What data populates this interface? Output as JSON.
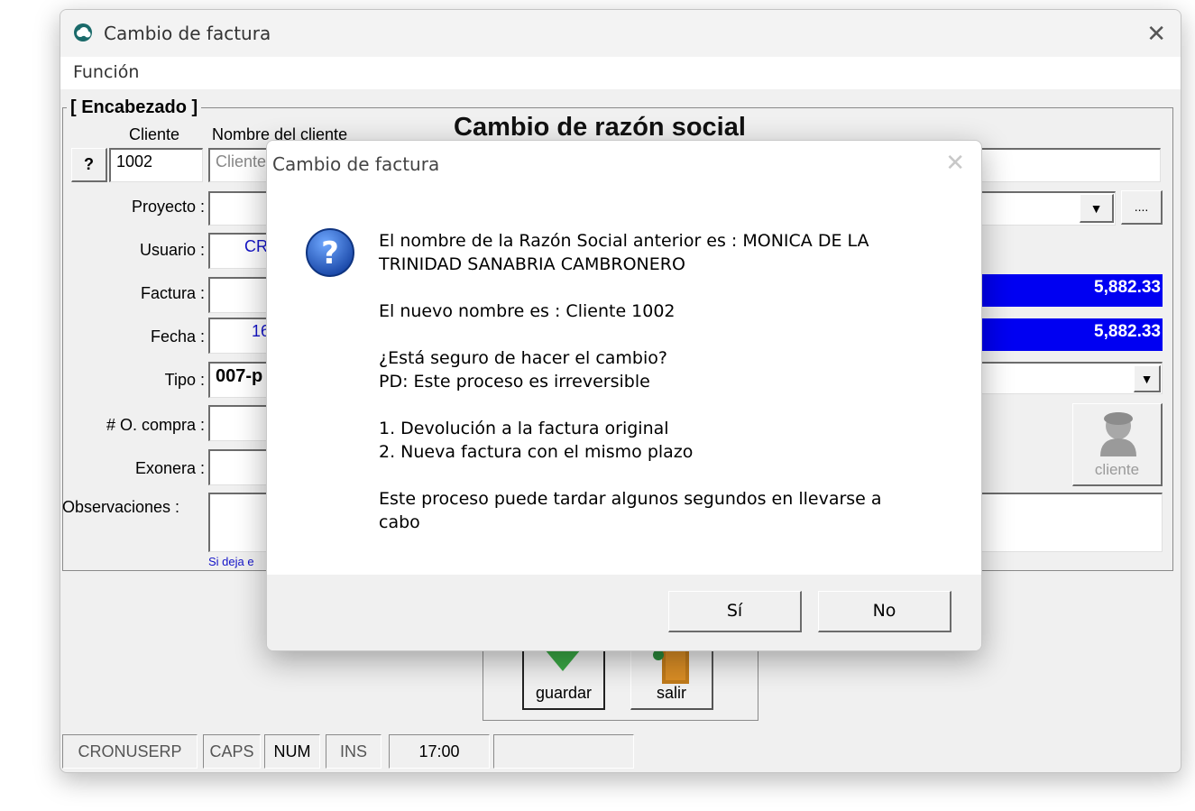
{
  "window": {
    "title": "Cambio de factura"
  },
  "menu": {
    "items": [
      "Función"
    ]
  },
  "form": {
    "group_title": "[ Encabezado ]",
    "heading": "Cambio de razón social",
    "cliente_header": "Cliente",
    "nombre_header": "Nombre del cliente",
    "help_button": "?",
    "cliente_code": "1002",
    "cliente_name": "Cliente",
    "proyecto_label": "Proyecto :",
    "usuario_label": "Usuario :",
    "usuario_value": "CR",
    "factura_label": "Factura :",
    "fecha_label": "Fecha :",
    "fecha_value": "16",
    "tipo_label": "Tipo :",
    "tipo_value": "007-p",
    "ocompra_label": "# O. compra :",
    "exonera_label": "Exonera :",
    "observaciones_label": "Observaciones :",
    "note": "Si deja e",
    "dots_button": "....",
    "amount1": "5,882.33",
    "amount2": "5,882.33",
    "cliente_button": "cliente"
  },
  "toolbar": {
    "guardar": "guardar",
    "salir": "salir"
  },
  "statusbar": {
    "user": "CRONUSERP",
    "caps": "CAPS",
    "num": "NUM",
    "ins": "INS",
    "time": "17:00",
    "extra": ""
  },
  "dialog": {
    "title": "Cambio de factura",
    "line1": "El nombre de la Razón Social anterior es : MONICA DE LA",
    "line2": "TRINIDAD SANABRIA CAMBRONERO",
    "line3": "El nuevo nombre es : Cliente 1002",
    "line4": "¿Está seguro de hacer el cambio?",
    "line5": "PD: Este proceso es irreversible",
    "line6": "1. Devolución a la factura original",
    "line7": "2. Nueva factura con el mismo plazo",
    "line8": "Este proceso puede tardar algunos segundos en llevarse a",
    "line9": "cabo",
    "yes": "Sí",
    "no": "No"
  },
  "colors": {
    "amount_bg": "#0000f2",
    "link_blue": "#1414c8",
    "icon_blue": "#1f5fbf"
  }
}
